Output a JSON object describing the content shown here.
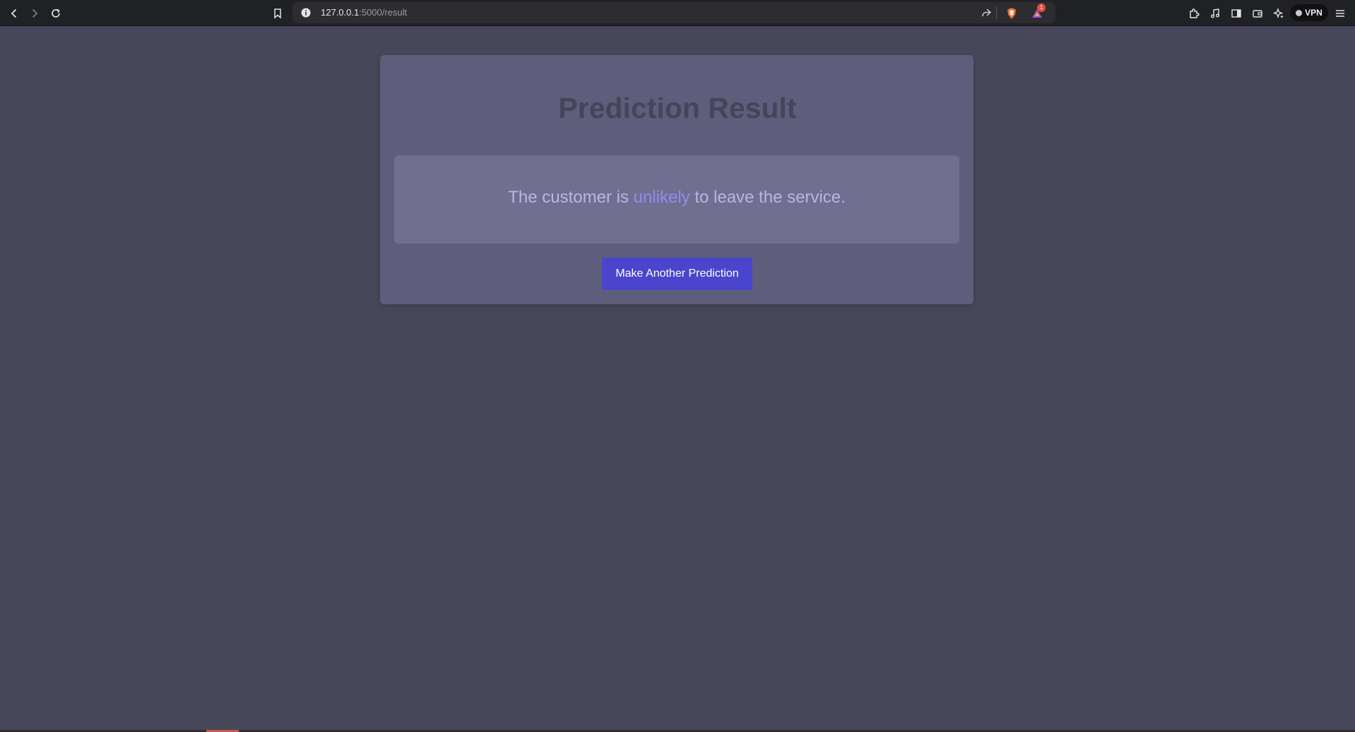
{
  "browser": {
    "url_host": "127.0.0.1",
    "url_path": ":5000/result",
    "vpn_label": "VPN",
    "notification_count": "1",
    "icons": [
      "back-icon",
      "forward-icon",
      "reload-icon",
      "bookmark-icon",
      "site-info-icon",
      "share-icon",
      "brave-shields-icon",
      "brave-rewards-icon",
      "extensions-icon",
      "media-icon",
      "sidebar-icon",
      "wallet-icon",
      "leo-ai-icon",
      "menu-icon"
    ]
  },
  "page": {
    "title": "Prediction Result",
    "result_prefix": "The customer is ",
    "result_highlight": "unlikely",
    "result_suffix": " to leave the service.",
    "button_label": "Make Another Prediction"
  },
  "colors": {
    "background": "#484759",
    "card": "#5e5d7b",
    "result_box": "#706f8f",
    "highlight": "#8f8cf3",
    "button": "#4a45cc"
  }
}
